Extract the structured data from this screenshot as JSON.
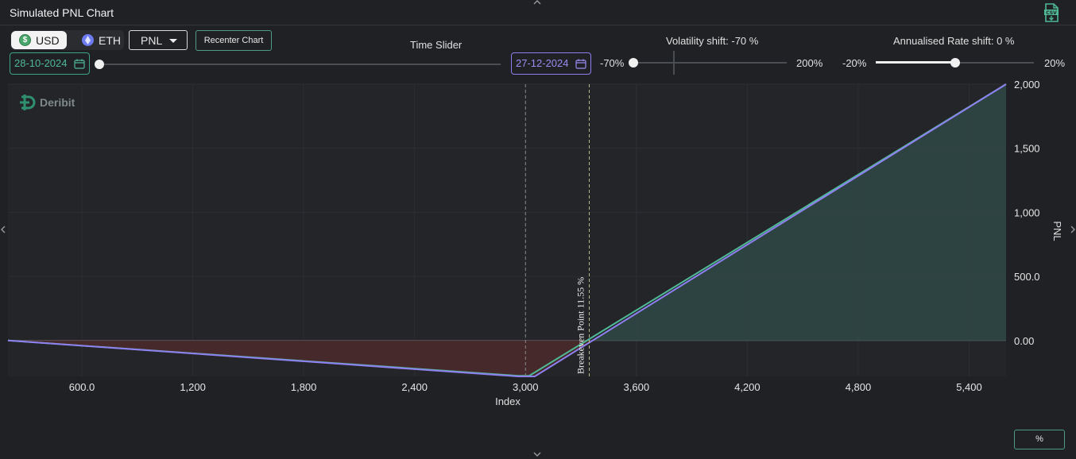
{
  "window": {
    "title": "Simulated PNL Chart"
  },
  "toolbar": {
    "currency_options": [
      "USD",
      "ETH"
    ],
    "currency_selected": "USD",
    "metric_selected": "PNL",
    "recenter_label": "Recenter Chart",
    "percent_label": "%"
  },
  "time_slider": {
    "label": "Time Slider",
    "start_date": "28-10-2024",
    "end_date": "27-12-2024",
    "position": 0
  },
  "volatility_slider": {
    "label": "Volatility shift: -70 %",
    "min_label": "-70%",
    "max_label": "200%",
    "min": -70,
    "max": 200,
    "value": -70
  },
  "rate_slider": {
    "label": "Annualised Rate shift: 0 %",
    "min_label": "-20%",
    "max_label": "20%",
    "min": -20,
    "max": 20,
    "value": 0
  },
  "brand": {
    "name": "Deribit"
  },
  "icons": {
    "csv": "csv-download-icon",
    "calendar": "calendar-icon"
  },
  "colors": {
    "accent_green": "#4fb895",
    "accent_purple": "#8f7ef0",
    "profit_fill": "#2e4443",
    "loss_fill": "#4a2a2a",
    "series_green": "#4fb895",
    "series_purple": "#8e80f0"
  },
  "chart_data": {
    "type": "line",
    "xlabel": "Index",
    "ylabel": "PNL",
    "xlim": [
      200,
      5600
    ],
    "ylim": [
      -280,
      2000
    ],
    "x_ticks": [
      600,
      1200,
      1800,
      2400,
      3000,
      3600,
      4200,
      4800,
      5400
    ],
    "x_tick_labels": [
      "600.0",
      "1,200",
      "1,800",
      "2,400",
      "3,000",
      "3,600",
      "4,200",
      "4,800",
      "5,400"
    ],
    "y_ticks": [
      0,
      500,
      1000,
      1500,
      2000
    ],
    "y_tick_labels": [
      "0.00",
      "500.0",
      "1,000",
      "1,500",
      "2,000"
    ],
    "series": [
      {
        "color": "#4fb895",
        "x": [
          200,
          2960,
          3020,
          5600
        ],
        "y": [
          0,
          -275,
          -275,
          2050
        ]
      },
      {
        "color": "#8e80f0",
        "x": [
          200,
          2960,
          3050,
          5600
        ],
        "y": [
          0,
          -280,
          -280,
          2000
        ]
      }
    ],
    "vlines": [
      {
        "x": 3000,
        "color": "#888888"
      },
      {
        "x": 3345,
        "color": "#b7b78a",
        "label": "Breakeven Point 11.55 %"
      }
    ],
    "grid": true,
    "legend": "none"
  }
}
